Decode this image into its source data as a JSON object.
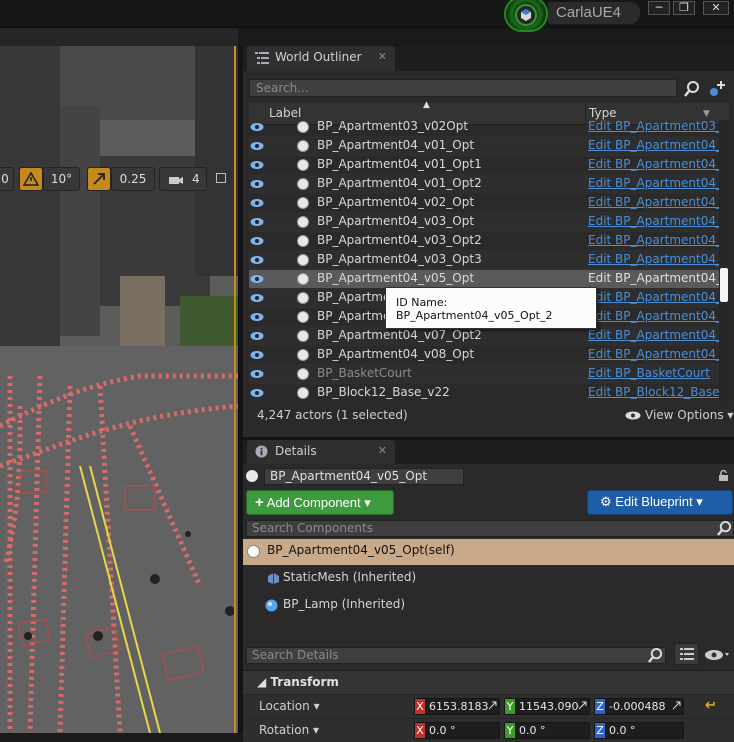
{
  "titlebar": {
    "project_name": "CarlaUE4",
    "minimize": "─",
    "maximize": "❐",
    "close": "✕"
  },
  "viewport": {
    "toolbar": {
      "grid_value": "0",
      "rotation_snap": "10°",
      "scale_snap": "0.25",
      "camera_speed": "4"
    }
  },
  "outliner": {
    "tab_label": "World Outliner",
    "search_placeholder": "Search...",
    "columns": {
      "label": "Label",
      "type": "Type"
    },
    "rows": [
      {
        "name": "BP_Apartment03_v02Opt",
        "type": "Edit BP_Apartment03_",
        "dim": false
      },
      {
        "name": "BP_Apartment04_v01_Opt",
        "type": "Edit BP_Apartment04_",
        "dim": false
      },
      {
        "name": "BP_Apartment04_v01_Opt1",
        "type": "Edit BP_Apartment04_",
        "dim": false
      },
      {
        "name": "BP_Apartment04_v01_Opt2",
        "type": "Edit BP_Apartment04_",
        "dim": false
      },
      {
        "name": "BP_Apartment04_v02_Opt",
        "type": "Edit BP_Apartment04_",
        "dim": false
      },
      {
        "name": "BP_Apartment04_v03_Opt",
        "type": "Edit BP_Apartment04_",
        "dim": false
      },
      {
        "name": "BP_Apartment04_v03_Opt2",
        "type": "Edit BP_Apartment04_",
        "dim": false
      },
      {
        "name": "BP_Apartment04_v03_Opt3",
        "type": "Edit BP_Apartment04_",
        "dim": false
      },
      {
        "name": "BP_Apartment04_v05_Opt",
        "type": "Edit BP_Apartment04_",
        "dim": false,
        "selected": true
      },
      {
        "name": "BP_Apartme",
        "type": "Edit BP_Apartment04_",
        "dim": false
      },
      {
        "name": "BP_Apartme",
        "type": "Edit BP_Apartment04_",
        "dim": false
      },
      {
        "name": "BP_Apartment04_v07_Opt2",
        "type": "Edit BP_Apartment04_",
        "dim": false
      },
      {
        "name": "BP_Apartment04_v08_Opt",
        "type": "Edit BP_Apartment04_",
        "dim": false
      },
      {
        "name": "BP_BasketCourt",
        "type": "Edit BP_BasketCourt",
        "dim": true
      },
      {
        "name": "BP_Block12_Base_v22",
        "type": "Edit BP_Block12_Base",
        "dim": false
      }
    ],
    "tooltip": "ID Name: BP_Apartment04_v05_Opt_2",
    "actor_count": "4,247 actors (1 selected)",
    "view_options": "View Options"
  },
  "details": {
    "tab_label": "Details",
    "actor_name": "BP_Apartment04_v05_Opt",
    "add_component": "Add Component",
    "edit_blueprint": "Edit Blueprint",
    "search_components_placeholder": "Search Components",
    "components": [
      {
        "label": "BP_Apartment04_v05_Opt(self)"
      },
      {
        "label": "StaticMesh (Inherited)"
      },
      {
        "label": "BP_Lamp (Inherited)"
      }
    ],
    "search_details_placeholder": "Search Details",
    "transform": {
      "section_label": "Transform",
      "location": {
        "label": "Location",
        "x": "6153.8183!",
        "y": "11543.090€",
        "z": "-0.000488"
      },
      "rotation": {
        "label": "Rotation",
        "x": "0.0 °",
        "y": "0.0 °",
        "z": "0.0 °"
      }
    }
  },
  "colors": {
    "selection_orange": "#c68a1c",
    "add_component_green": "#3e9a3e",
    "edit_blueprint_blue": "#1f5ea6",
    "link_blue": "#4a8ed8",
    "self_component_tan": "#c8a98a",
    "axis_x": "#c33030",
    "axis_y": "#3f9a2a",
    "axis_z": "#2f63c6"
  }
}
